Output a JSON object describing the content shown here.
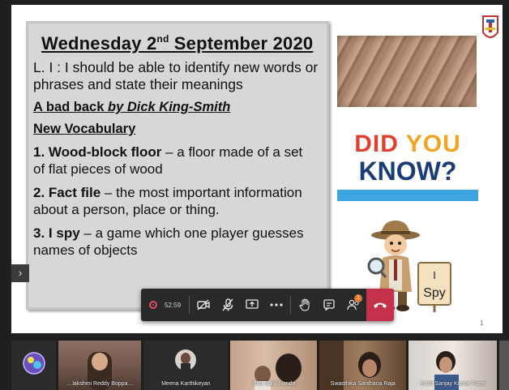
{
  "slide": {
    "title_main": "Wednesday 2",
    "title_sup": "nd",
    "title_rest": " September 2020",
    "learning_intention": "L. I : I should be able to identify new words or phrases and state their meanings",
    "book_title": "A bad back",
    "book_by": "by Dick King-Smith",
    "vocab_heading": "New Vocabulary",
    "vocab": [
      {
        "num": "1.",
        "term": "Wood-block floor",
        "def_line1": " – a floor made of a set",
        "def_line2": "of flat pieces of wood"
      },
      {
        "num": "2.",
        "term": "Fact file",
        "def_line1": " – the most important information",
        "def_line2": "about a person, place or thing."
      },
      {
        "num": "3.",
        "term": "I spy",
        "def_line1": " – a game which one player guesses",
        "def_line2": "names of objects"
      }
    ],
    "did_you_know": {
      "did": "DID",
      "you": "YOU",
      "know": "KNOW?"
    },
    "spy_sign_line1": "I",
    "spy_sign_line2": "Spy",
    "page_number": "1"
  },
  "meeting": {
    "recording_time": "52:59",
    "icons": [
      "record-icon",
      "video-off-icon",
      "mic-off-icon",
      "share-screen-icon",
      "more-icon",
      "raise-hand-icon",
      "chat-icon",
      "participants-icon",
      "hang-up-icon"
    ],
    "participants_badge": "1",
    "hangup_color": "#c4314b"
  },
  "participants": [
    {
      "name": ""
    },
    {
      "name": "…lakshmi Reddy Boppa…"
    },
    {
      "name": "Meena Karthikeyan"
    },
    {
      "name": "Isha Sunil Nanda"
    },
    {
      "name": "Swasthika Santhana Raja"
    },
    {
      "name": "Krish Sanjay Kumar Patel"
    },
    {
      "name": ""
    }
  ],
  "colors": {
    "panel_bg": "#d7d7d7",
    "did_red": "#e2402f",
    "you_orange": "#f4a321",
    "know_navy": "#1a3e73",
    "stage_bg": "#1f1f1f"
  }
}
